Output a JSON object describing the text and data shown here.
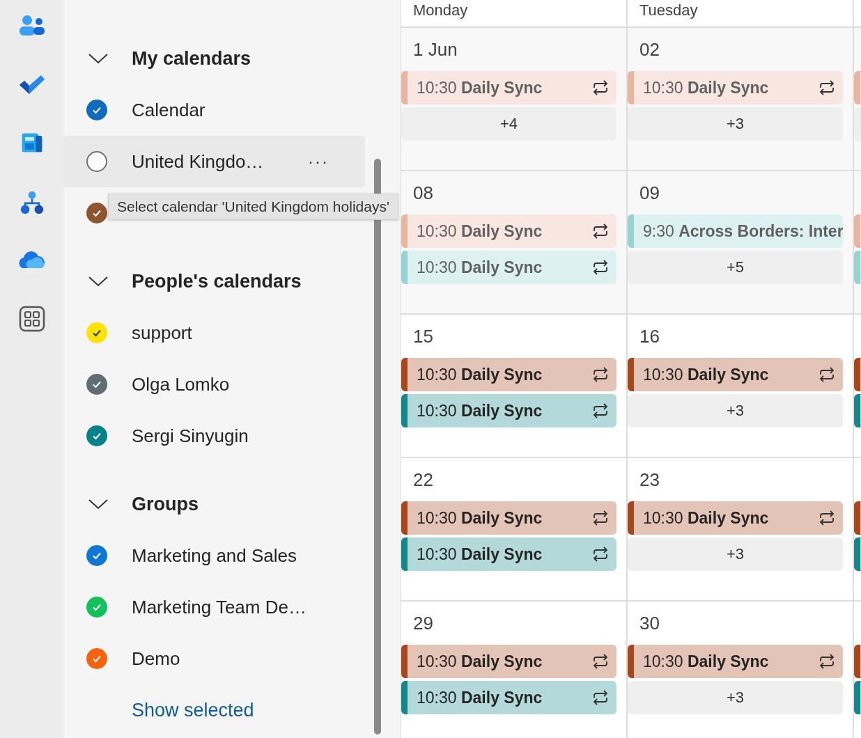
{
  "sidebar": {
    "groups": [
      {
        "title": "My calendars",
        "expanded": true,
        "items": [
          {
            "label": "Calendar",
            "checked": true,
            "color": "#0f6cbd",
            "highlighted": false
          },
          {
            "label": "United Kingdo…",
            "checked": false,
            "highlighted": true,
            "menu": "···"
          },
          {
            "checked": true,
            "color": "#8e562e",
            "highlighted": false
          }
        ]
      },
      {
        "title": "People's calendars",
        "expanded": true,
        "items": [
          {
            "label": "support",
            "checked": true,
            "color": "#fde300",
            "highlighted": false
          },
          {
            "label": "Olga Lomko",
            "checked": true,
            "color": "#5f6e72",
            "highlighted": false
          },
          {
            "label": "Sergi Sinyugin",
            "checked": true,
            "color": "#038387",
            "highlighted": false
          }
        ]
      },
      {
        "title": "Groups",
        "expanded": true,
        "items": [
          {
            "label": "Marketing and Sales",
            "checked": true,
            "color": "#0f78d4",
            "highlighted": false
          },
          {
            "label": "Marketing Team De…",
            "checked": true,
            "color": "#13c15a",
            "highlighted": false
          },
          {
            "label": "Demo",
            "checked": true,
            "color": "#f7630c",
            "highlighted": false
          }
        ]
      }
    ],
    "show_selected": "Show selected"
  },
  "tooltip": "Select calendar 'United Kingdom holidays'",
  "calendar": {
    "weekdays": [
      "Monday",
      "Tuesday"
    ],
    "weeks": [
      {
        "past": true,
        "days": [
          {
            "date": "1 Jun",
            "events": [
              {
                "kind": "event",
                "time": "10:30",
                "title": "Daily Sync",
                "recurring": true,
                "color": "#e8b5a0"
              },
              {
                "kind": "more",
                "label": "+4"
              }
            ]
          },
          {
            "date": "02",
            "events": [
              {
                "kind": "event",
                "time": "10:30",
                "title": "Daily Sync",
                "recurring": true,
                "color": "#e8b5a0"
              },
              {
                "kind": "more",
                "label": "+3"
              }
            ]
          },
          {
            "events": [
              {
                "kind": "event",
                "color": "#e8b5a0"
              },
              {
                "kind": "more"
              }
            ]
          }
        ]
      },
      {
        "past": true,
        "days": [
          {
            "date": "08",
            "events": [
              {
                "kind": "event",
                "time": "10:30",
                "title": "Daily Sync",
                "recurring": true,
                "color": "#e8b5a0"
              },
              {
                "kind": "event",
                "time": "10:30",
                "title": "Daily Sync",
                "recurring": true,
                "color": "#98d3d4"
              }
            ]
          },
          {
            "date": "09",
            "events": [
              {
                "kind": "event",
                "time": "9:30",
                "title": "Across Borders: Inter",
                "recurring": false,
                "color": "#98d3d4"
              },
              {
                "kind": "more",
                "label": "+5"
              }
            ]
          },
          {
            "events": [
              {
                "kind": "event",
                "color": "#e8b5a0"
              },
              {
                "kind": "event",
                "color": "#98d3d4"
              }
            ]
          }
        ]
      },
      {
        "past": false,
        "days": [
          {
            "date": "15",
            "events": [
              {
                "kind": "event",
                "time": "10:30",
                "title": "Daily Sync",
                "recurring": true,
                "color": "#a9461c"
              },
              {
                "kind": "event",
                "time": "10:30",
                "title": "Daily Sync",
                "recurring": true,
                "color": "#14878a"
              }
            ]
          },
          {
            "date": "16",
            "events": [
              {
                "kind": "event",
                "time": "10:30",
                "title": "Daily Sync",
                "recurring": true,
                "color": "#a9461c"
              },
              {
                "kind": "more",
                "label": "+3"
              }
            ]
          },
          {
            "events": [
              {
                "kind": "event",
                "color": "#a9461c"
              },
              {
                "kind": "event",
                "color": "#14878a"
              }
            ]
          }
        ]
      },
      {
        "past": false,
        "days": [
          {
            "date": "22",
            "events": [
              {
                "kind": "event",
                "time": "10:30",
                "title": "Daily Sync",
                "recurring": true,
                "color": "#a9461c"
              },
              {
                "kind": "event",
                "time": "10:30",
                "title": "Daily Sync",
                "recurring": true,
                "color": "#14878a"
              }
            ]
          },
          {
            "date": "23",
            "events": [
              {
                "kind": "event",
                "time": "10:30",
                "title": "Daily Sync",
                "recurring": true,
                "color": "#a9461c"
              },
              {
                "kind": "more",
                "label": "+3"
              }
            ]
          },
          {
            "events": [
              {
                "kind": "event",
                "color": "#a9461c"
              },
              {
                "kind": "event",
                "color": "#14878a"
              }
            ]
          }
        ]
      },
      {
        "past": false,
        "days": [
          {
            "date": "29",
            "events": [
              {
                "kind": "event",
                "time": "10:30",
                "title": "Daily Sync",
                "recurring": true,
                "color": "#a9461c"
              },
              {
                "kind": "event",
                "time": "10:30",
                "title": "Daily Sync",
                "recurring": true,
                "color": "#14878a"
              }
            ]
          },
          {
            "date": "30",
            "events": [
              {
                "kind": "event",
                "time": "10:30",
                "title": "Daily Sync",
                "recurring": true,
                "color": "#a9461c"
              },
              {
                "kind": "more",
                "label": "+3"
              }
            ]
          },
          {
            "events": [
              {
                "kind": "event",
                "color": "#a9461c"
              },
              {
                "kind": "event",
                "color": "#14878a"
              }
            ]
          }
        ]
      }
    ]
  }
}
